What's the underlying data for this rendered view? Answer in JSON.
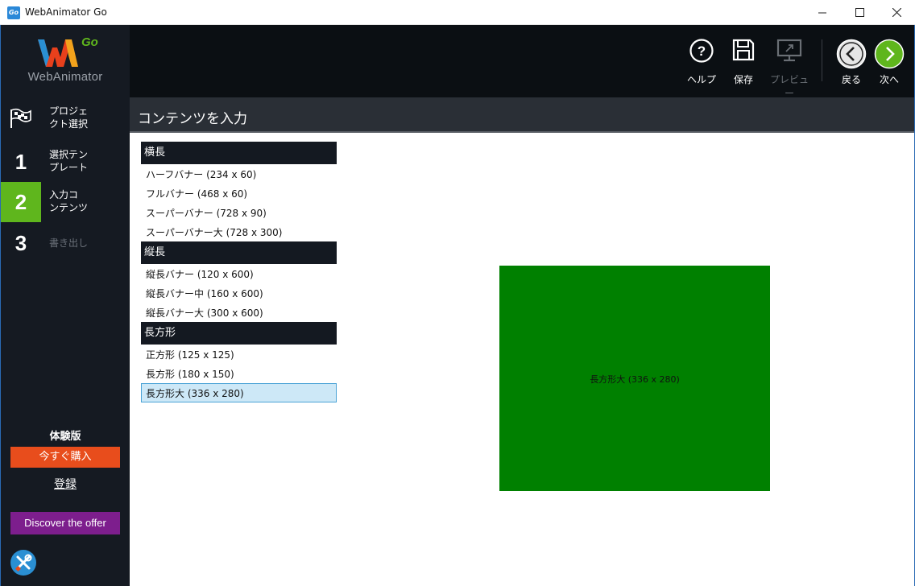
{
  "window": {
    "title": "WebAnimator Go",
    "app_icon_text": "Go",
    "controls": [
      "minimize",
      "maximize",
      "close"
    ]
  },
  "sidebar": {
    "logo": {
      "mark": "WA",
      "accent": "Go",
      "name": "WebAnimator"
    },
    "steps": [
      {
        "num": "",
        "icon": "flag-icon",
        "label": "プロジェ\nクト選択",
        "state": "normal"
      },
      {
        "num": "1",
        "label": "選択テン\nプレート",
        "state": "normal"
      },
      {
        "num": "2",
        "label": "入力コ\nンテンツ",
        "state": "active"
      },
      {
        "num": "3",
        "label": "書き出し",
        "state": "disabled"
      }
    ],
    "trial_label": "体験版",
    "buy_label": "今すぐ購入",
    "register_label": "登録",
    "offer_label": "Discover the offer",
    "tools_icon": "tools-icon"
  },
  "toolbar": {
    "help_label": "ヘルプ",
    "save_label": "保存",
    "preview_label": "プレビュー",
    "back_label": "戻る",
    "next_label": "次へ"
  },
  "section": {
    "title": "コンテンツを入力"
  },
  "formats": {
    "categories": [
      {
        "name": "横長",
        "items": [
          "ハーフバナー (234 x 60)",
          "フルバナー (468 x 60)",
          "スーパーバナー (728 x 90)",
          "スーパーバナー大 (728 x 300)"
        ]
      },
      {
        "name": "縦長",
        "items": [
          "縦長バナー (120 x 600)",
          "縦長バナー中 (160 x 600)",
          "縦長バナー大 (300 x 600)"
        ]
      },
      {
        "name": "長方形",
        "items": [
          "正方形 (125 x 125)",
          "長方形 (180 x 150)",
          "長方形大 (336 x 280)"
        ]
      }
    ],
    "selected": "長方形大 (336 x 280)"
  },
  "preview": {
    "label": "長方形大 (336 x 280)",
    "color": "#008000"
  },
  "colors": {
    "sidebar_bg": "#151a22",
    "toolbar_bg": "#0b0f13",
    "active_step": "#5fb61d",
    "buy_button": "#e84d1c",
    "offer_button": "#7d1e8d",
    "next_button": "#5fb61d",
    "selection": "#cde8f7"
  }
}
